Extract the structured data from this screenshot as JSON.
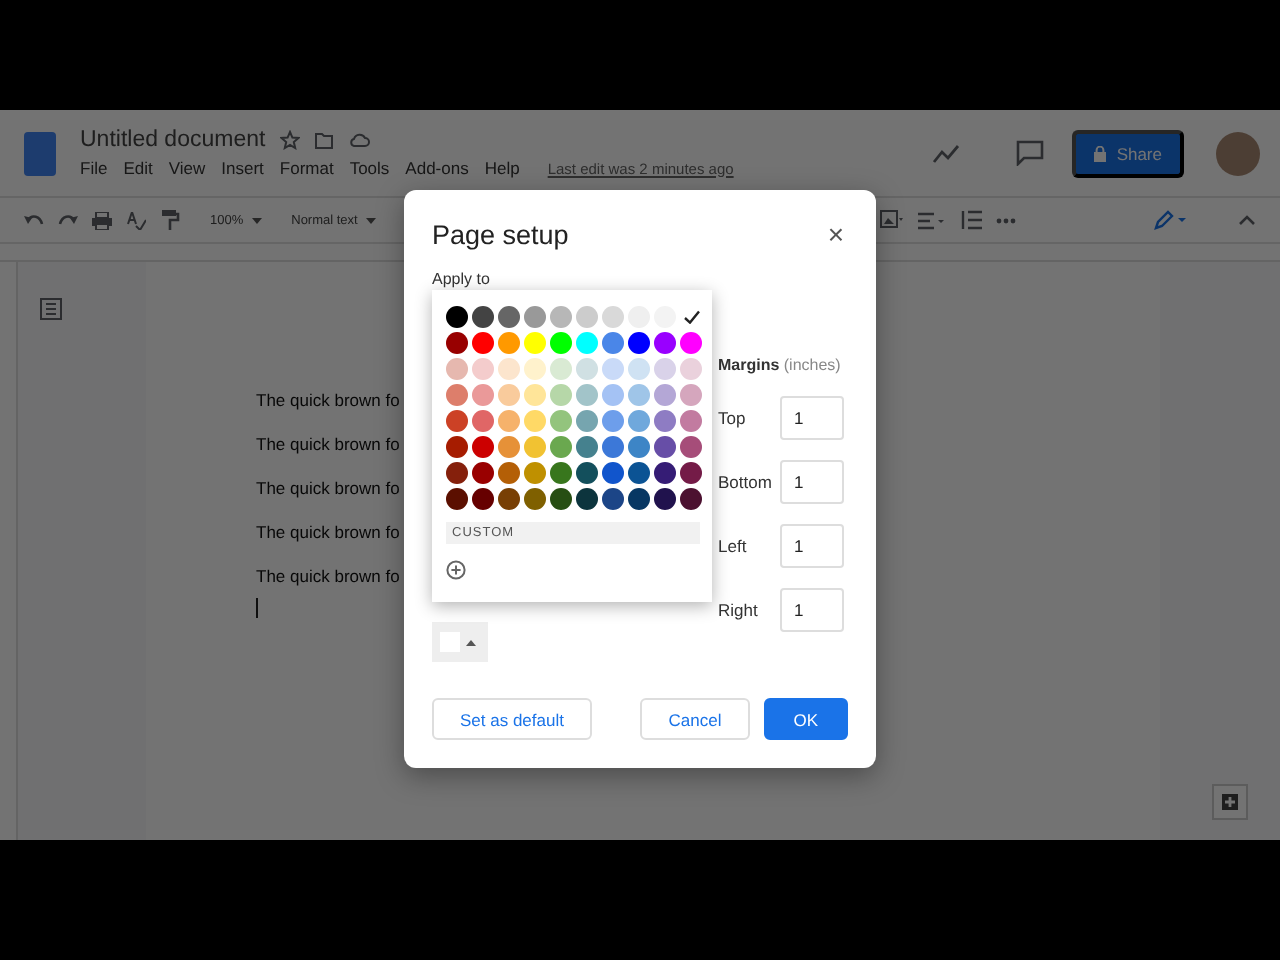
{
  "document": {
    "title": "Untitled document",
    "menu": [
      "File",
      "Edit",
      "View",
      "Insert",
      "Format",
      "Tools",
      "Add-ons",
      "Help"
    ],
    "last_edit": "Last edit was 2 minutes ago",
    "share": "Share"
  },
  "toolbar": {
    "zoom": "100%",
    "style": "Normal text"
  },
  "body_lines": [
    "The quick brown fo",
    "The quick brown fo",
    "The quick brown fo",
    "The quick brown fo",
    "The quick brown fo"
  ],
  "dialog": {
    "title": "Page setup",
    "close": "×",
    "apply_to": "Apply to",
    "margins_label": "**Margins** (inches)",
    "margins": [
      {
        "label": "Top",
        "value": "1"
      },
      {
        "label": "Bottom",
        "value": "1"
      },
      {
        "label": "Left",
        "value": "1"
      },
      {
        "label": "Right",
        "value": "1"
      }
    ],
    "buttons": [
      {
        "label": "Set as default",
        "kind": "outline"
      },
      {
        "label": "Cancel",
        "kind": "outline"
      },
      {
        "label": "OK",
        "kind": "primary"
      }
    ]
  },
  "color_picker": {
    "custom_label": "CUSTOM",
    "palette": [
      [
        {
          "color": "#000000",
          "selected": false
        },
        {
          "color": "#434343",
          "selected": false
        },
        {
          "color": "#666666",
          "selected": false
        },
        {
          "color": "#999999",
          "selected": false
        },
        {
          "color": "#b7b7b7",
          "selected": false
        },
        {
          "color": "#cccccc",
          "selected": false
        },
        {
          "color": "#d9d9d9",
          "selected": false
        },
        {
          "color": "#efefef",
          "selected": false
        },
        {
          "color": "#f3f3f3",
          "selected": false
        },
        {
          "color": "#ffffff",
          "selected": true
        }
      ],
      [
        {
          "color": "#980000",
          "selected": false
        },
        {
          "color": "#ff0000",
          "selected": false
        },
        {
          "color": "#ff9900",
          "selected": false
        },
        {
          "color": "#ffff00",
          "selected": false
        },
        {
          "color": "#00ff00",
          "selected": false
        },
        {
          "color": "#00ffff",
          "selected": false
        },
        {
          "color": "#4a86e8",
          "selected": false
        },
        {
          "color": "#0000ff",
          "selected": false
        },
        {
          "color": "#9900ff",
          "selected": false
        },
        {
          "color": "#ff00ff",
          "selected": false
        }
      ],
      [
        {
          "color": "#e6b8af",
          "selected": false
        },
        {
          "color": "#f4cccc",
          "selected": false
        },
        {
          "color": "#fce5cd",
          "selected": false
        },
        {
          "color": "#fff2cc",
          "selected": false
        },
        {
          "color": "#d9ead3",
          "selected": false
        },
        {
          "color": "#d0e0e3",
          "selected": false
        },
        {
          "color": "#c9daf8",
          "selected": false
        },
        {
          "color": "#cfe2f3",
          "selected": false
        },
        {
          "color": "#d9d2e9",
          "selected": false
        },
        {
          "color": "#ead1dc",
          "selected": false
        }
      ],
      [
        {
          "color": "#dd7e6b",
          "selected": false
        },
        {
          "color": "#ea9999",
          "selected": false
        },
        {
          "color": "#f9cb9c",
          "selected": false
        },
        {
          "color": "#ffe599",
          "selected": false
        },
        {
          "color": "#b6d7a8",
          "selected": false
        },
        {
          "color": "#a2c4c9",
          "selected": false
        },
        {
          "color": "#a4c2f4",
          "selected": false
        },
        {
          "color": "#9fc5e8",
          "selected": false
        },
        {
          "color": "#b4a7d6",
          "selected": false
        },
        {
          "color": "#d5a6bd",
          "selected": false
        }
      ],
      [
        {
          "color": "#cc4125",
          "selected": false
        },
        {
          "color": "#e06666",
          "selected": false
        },
        {
          "color": "#f6b26b",
          "selected": false
        },
        {
          "color": "#ffd966",
          "selected": false
        },
        {
          "color": "#93c47d",
          "selected": false
        },
        {
          "color": "#76a5af",
          "selected": false
        },
        {
          "color": "#6d9eeb",
          "selected": false
        },
        {
          "color": "#6fa8dc",
          "selected": false
        },
        {
          "color": "#8e7cc3",
          "selected": false
        },
        {
          "color": "#c27ba0",
          "selected": false
        }
      ],
      [
        {
          "color": "#a61c00",
          "selected": false
        },
        {
          "color": "#cc0000",
          "selected": false
        },
        {
          "color": "#e69138",
          "selected": false
        },
        {
          "color": "#f1c232",
          "selected": false
        },
        {
          "color": "#6aa84f",
          "selected": false
        },
        {
          "color": "#45818e",
          "selected": false
        },
        {
          "color": "#3c78d8",
          "selected": false
        },
        {
          "color": "#3d85c6",
          "selected": false
        },
        {
          "color": "#674ea7",
          "selected": false
        },
        {
          "color": "#a64d79",
          "selected": false
        }
      ],
      [
        {
          "color": "#85200c",
          "selected": false
        },
        {
          "color": "#990000",
          "selected": false
        },
        {
          "color": "#b45f06",
          "selected": false
        },
        {
          "color": "#bf9000",
          "selected": false
        },
        {
          "color": "#38761d",
          "selected": false
        },
        {
          "color": "#134f5c",
          "selected": false
        },
        {
          "color": "#1155cc",
          "selected": false
        },
        {
          "color": "#0b5394",
          "selected": false
        },
        {
          "color": "#351c75",
          "selected": false
        },
        {
          "color": "#741b47",
          "selected": false
        }
      ],
      [
        {
          "color": "#5b0f00",
          "selected": false
        },
        {
          "color": "#660000",
          "selected": false
        },
        {
          "color": "#783f04",
          "selected": false
        },
        {
          "color": "#7f6000",
          "selected": false
        },
        {
          "color": "#274e13",
          "selected": false
        },
        {
          "color": "#0c343d",
          "selected": false
        },
        {
          "color": "#1c4587",
          "selected": false
        },
        {
          "color": "#073763",
          "selected": false
        },
        {
          "color": "#20124d",
          "selected": false
        },
        {
          "color": "#4c1130",
          "selected": false
        }
      ]
    ]
  }
}
